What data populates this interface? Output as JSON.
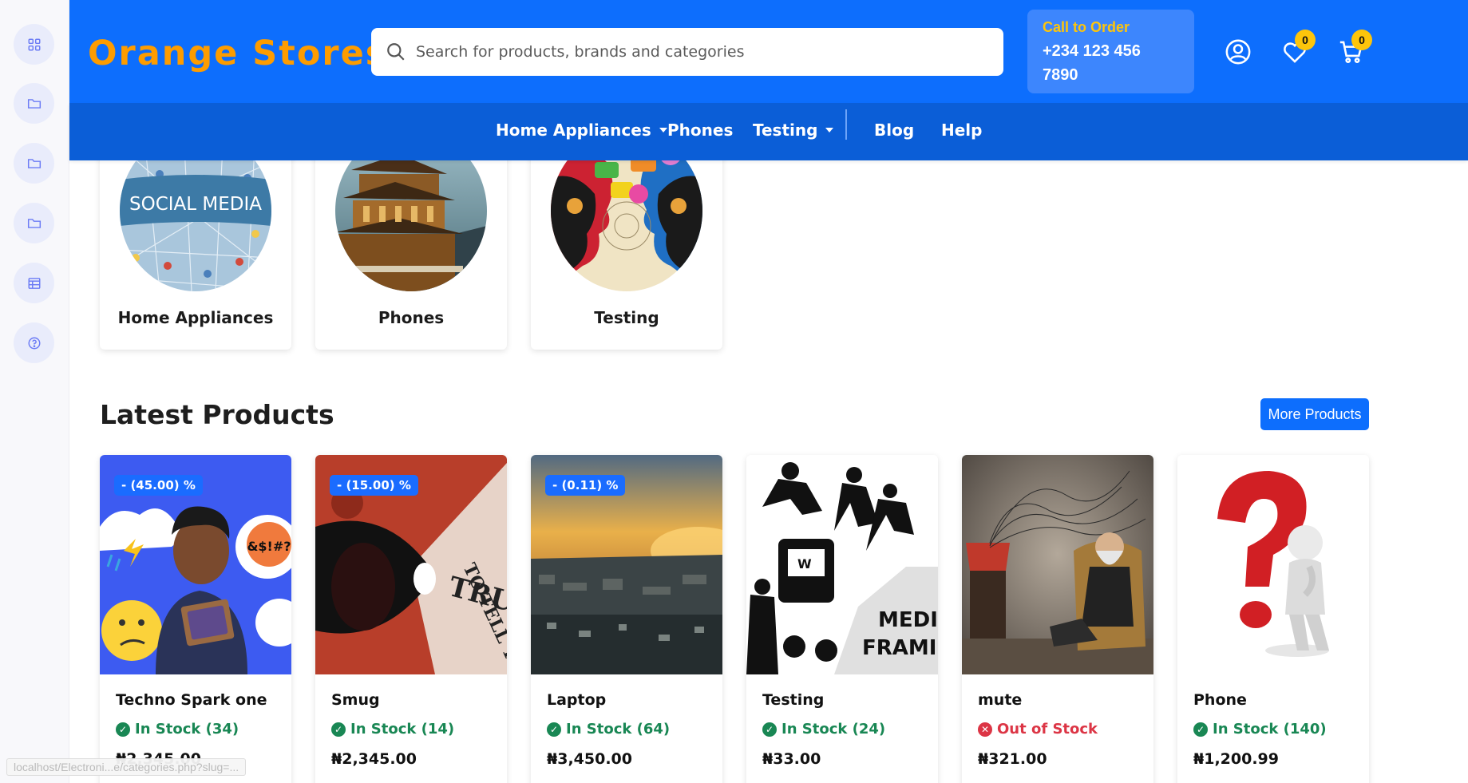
{
  "sidebar": {
    "items": [
      {
        "icon": "grid-icon"
      },
      {
        "icon": "folder-icon"
      },
      {
        "icon": "folder-icon"
      },
      {
        "icon": "folder-icon"
      },
      {
        "icon": "table-icon"
      },
      {
        "icon": "help-icon"
      }
    ]
  },
  "header": {
    "logo": "Orange Stores",
    "search_placeholder": "Search for products, brands and categories",
    "call_label": "Call to Order",
    "call_number": "+234 123 456 7890",
    "wishlist_count": "0",
    "cart_count": "0"
  },
  "nav": {
    "items": [
      "Home Appliances",
      "Phones",
      "Testing",
      "Blog",
      "Help"
    ]
  },
  "categories": [
    {
      "name": "Home Appliances"
    },
    {
      "name": "Phones"
    },
    {
      "name": "Testing"
    }
  ],
  "latest": {
    "title": "Latest Products",
    "more_label": "More Products"
  },
  "products": [
    {
      "name": "Techno Spark one",
      "stock": "In Stock (34)",
      "in_stock": true,
      "price": "₦2,345.00",
      "discount": "- (45.00) %"
    },
    {
      "name": "Smug",
      "stock": "In Stock (14)",
      "in_stock": true,
      "price": "₦2,345.00",
      "discount": "- (15.00) %"
    },
    {
      "name": "Laptop",
      "stock": "In Stock (64)",
      "in_stock": true,
      "price": "₦3,450.00",
      "discount": "- (0.11) %"
    },
    {
      "name": "Testing",
      "stock": "In Stock (24)",
      "in_stock": true,
      "price": "₦33.00",
      "discount": ""
    },
    {
      "name": "mute",
      "stock": "Out of Stock",
      "in_stock": false,
      "price": "₦321.00",
      "discount": ""
    },
    {
      "name": "Phone",
      "stock": "In Stock (140)",
      "in_stock": true,
      "price": "₦1,200.99",
      "discount": ""
    }
  ],
  "status_bar": {
    "url": "localhost/Electroni...e/categories.php?slug=..."
  },
  "colors": {
    "primary": "#0d6efd",
    "nav": "#0b5ed7",
    "logo": "#fd9c00",
    "badge": "#fdc50b",
    "in_stock": "#198754",
    "out_of_stock": "#dc3545"
  }
}
